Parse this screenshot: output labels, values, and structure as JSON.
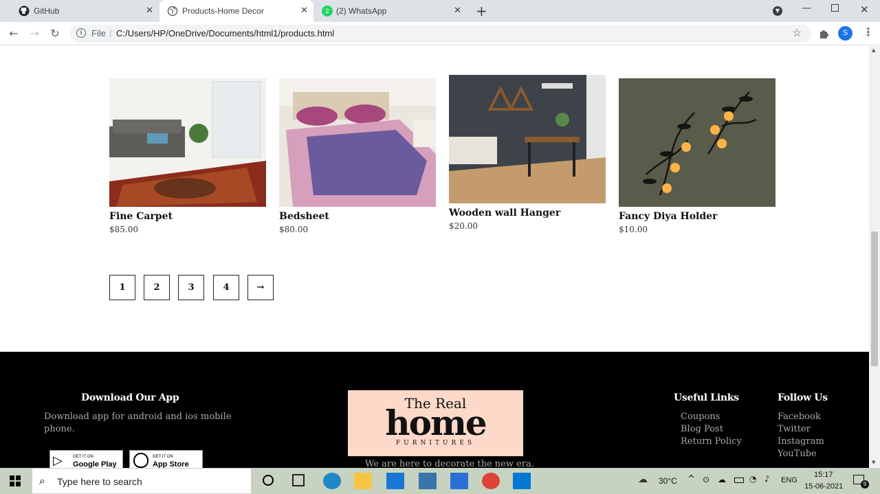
{
  "browser": {
    "tabs": [
      {
        "title": "GitHub",
        "icon": "github-icon"
      },
      {
        "title": "Products-Home Decor",
        "icon": "globe-icon",
        "active": true
      },
      {
        "title": "(2) WhatsApp",
        "icon": "whatsapp-icon",
        "badge": "2"
      }
    ],
    "address_prefix": "File",
    "address": "C:/Users/HP/OneDrive/Documents/html1/products.html",
    "profile_initial": "S"
  },
  "products": [
    {
      "name": "Fine Carpet",
      "price": "$85.00"
    },
    {
      "name": "Bedsheet",
      "price": "$80.00"
    },
    {
      "name": "Wooden wall Hanger",
      "price": "$20.00"
    },
    {
      "name": "Fancy Diya Holder",
      "price": "$10.00"
    }
  ],
  "pagination": [
    "1",
    "2",
    "3",
    "4",
    "→"
  ],
  "footer": {
    "app_heading": "Download Our App",
    "app_text_line1": "Download app for android and ios mobile",
    "app_text_line2": "phone.",
    "google_play_small": "GET IT ON",
    "google_play": "Google Play",
    "app_store_small": "GET IT ON",
    "app_store": "App Store",
    "logo_top": "The Real",
    "logo_main": "home",
    "logo_sub": "FURNITURES",
    "tagline": "We are here to decorate the new era.",
    "useful_heading": "Useful Links",
    "useful_links": [
      "Coupons",
      "Blog Post",
      "Return Policy"
    ],
    "follow_heading": "Follow Us",
    "follow_links": [
      "Facebook",
      "Twitter",
      "Instagram",
      "YouTube"
    ]
  },
  "taskbar": {
    "search_placeholder": "Type here to search",
    "temperature": "30°C",
    "language": "ENG",
    "time": "15:17",
    "date": "15-06-2021",
    "notification_count": "9"
  }
}
